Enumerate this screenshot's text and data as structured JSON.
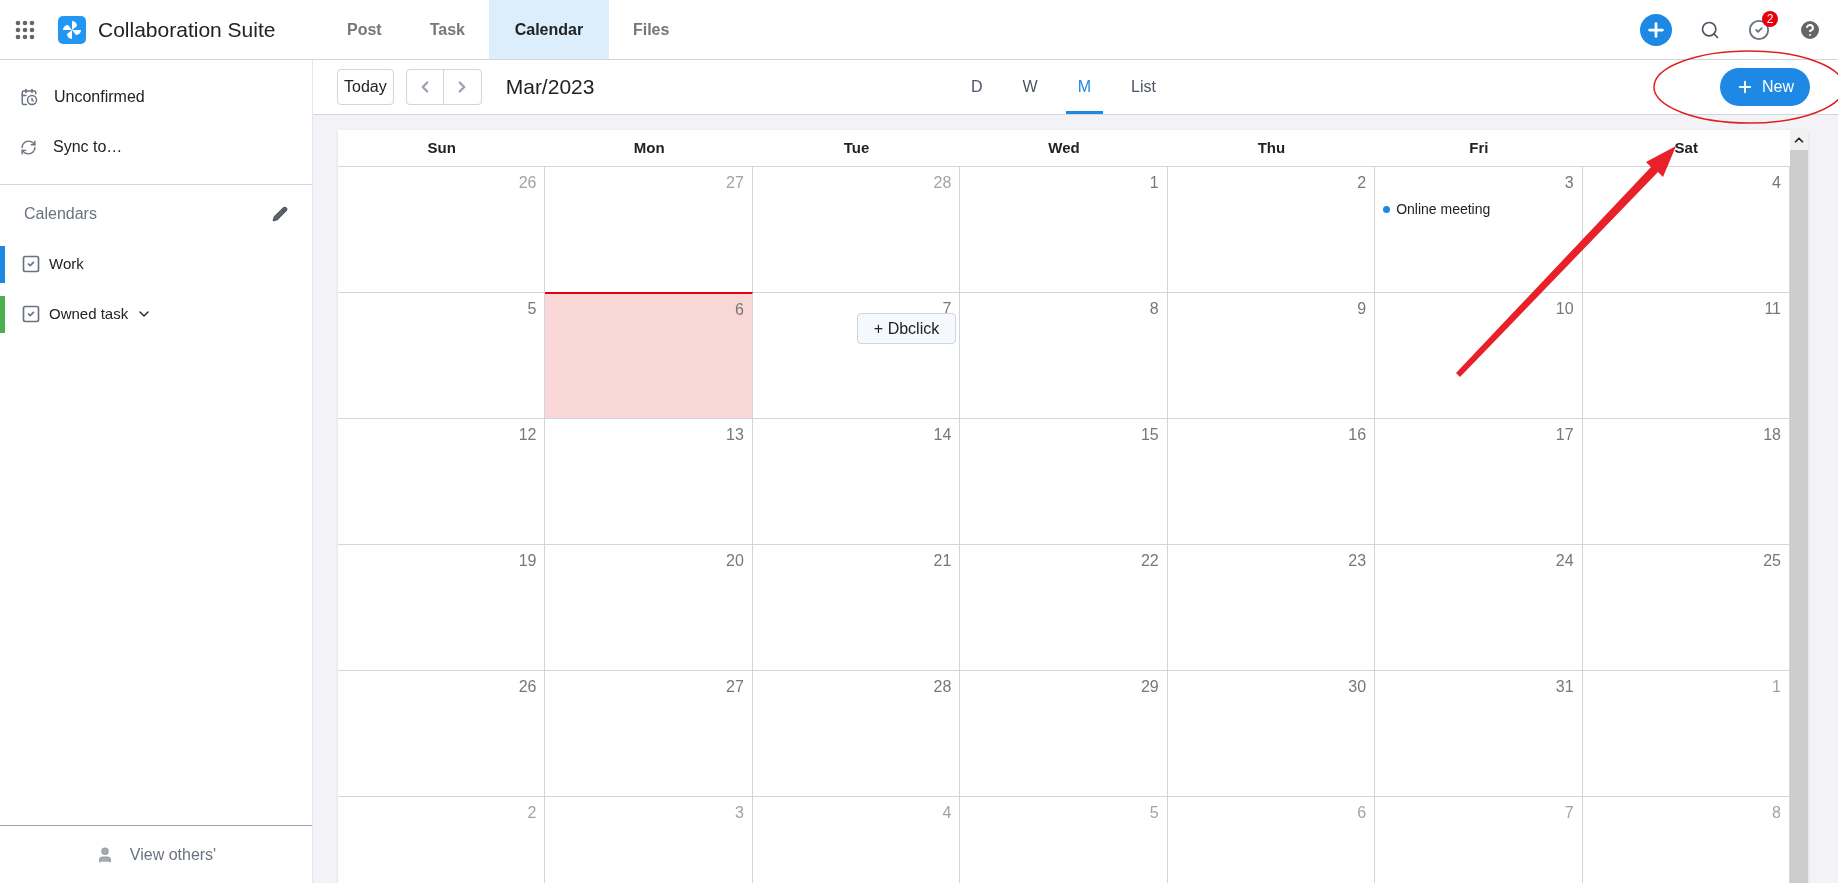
{
  "app": {
    "title": "Collaboration Suite"
  },
  "tabs": [
    {
      "label": "Post",
      "selected": false
    },
    {
      "label": "Task",
      "selected": false
    },
    {
      "label": "Calendar",
      "selected": true
    },
    {
      "label": "Files",
      "selected": false
    }
  ],
  "notifications": {
    "badge": "2"
  },
  "sidebar": {
    "items": [
      {
        "label": "Unconfirmed",
        "kind": "unconfirmed"
      },
      {
        "label": "Sync to…",
        "kind": "sync"
      }
    ],
    "calendars_heading": "Calendars",
    "calendars": [
      {
        "label": "Work",
        "color": "#1e88e5",
        "checked": true,
        "kind": "plain"
      },
      {
        "label": "Owned task",
        "color": "#4caf50",
        "checked": true,
        "kind": "dropdown"
      }
    ],
    "footer": "View others'"
  },
  "toolbar": {
    "today": "Today",
    "period": "Mar/2023",
    "views": [
      {
        "label": "D",
        "selected": false
      },
      {
        "label": "W",
        "selected": false
      },
      {
        "label": "M",
        "selected": true
      },
      {
        "label": "List",
        "selected": false
      }
    ],
    "new_button": "New"
  },
  "calendar": {
    "weekdays": [
      "Sun",
      "Mon",
      "Tue",
      "Wed",
      "Thu",
      "Fri",
      "Sat"
    ],
    "weeks": [
      [
        {
          "day": "26",
          "in_month": false
        },
        {
          "day": "27",
          "in_month": false
        },
        {
          "day": "28",
          "in_month": false
        },
        {
          "day": "1",
          "in_month": true
        },
        {
          "day": "2",
          "in_month": true
        },
        {
          "day": "3",
          "in_month": true,
          "events": [
            {
              "title": "Online meeting",
              "color": "#1e88e5"
            }
          ]
        },
        {
          "day": "4",
          "in_month": true
        }
      ],
      [
        {
          "day": "5",
          "in_month": true
        },
        {
          "day": "6",
          "in_month": true,
          "today": true
        },
        {
          "day": "7",
          "in_month": true,
          "hint": "+ Dbclick"
        },
        {
          "day": "8",
          "in_month": true
        },
        {
          "day": "9",
          "in_month": true
        },
        {
          "day": "10",
          "in_month": true
        },
        {
          "day": "11",
          "in_month": true
        }
      ],
      [
        {
          "day": "12",
          "in_month": true
        },
        {
          "day": "13",
          "in_month": true
        },
        {
          "day": "14",
          "in_month": true
        },
        {
          "day": "15",
          "in_month": true
        },
        {
          "day": "16",
          "in_month": true
        },
        {
          "day": "17",
          "in_month": true
        },
        {
          "day": "18",
          "in_month": true
        }
      ],
      [
        {
          "day": "19",
          "in_month": true
        },
        {
          "day": "20",
          "in_month": true
        },
        {
          "day": "21",
          "in_month": true
        },
        {
          "day": "22",
          "in_month": true
        },
        {
          "day": "23",
          "in_month": true
        },
        {
          "day": "24",
          "in_month": true
        },
        {
          "day": "25",
          "in_month": true
        }
      ],
      [
        {
          "day": "26",
          "in_month": true
        },
        {
          "day": "27",
          "in_month": true
        },
        {
          "day": "28",
          "in_month": true
        },
        {
          "day": "29",
          "in_month": true
        },
        {
          "day": "30",
          "in_month": true
        },
        {
          "day": "31",
          "in_month": true
        },
        {
          "day": "1",
          "in_month": false
        }
      ],
      [
        {
          "day": "2",
          "in_month": false
        },
        {
          "day": "3",
          "in_month": false
        },
        {
          "day": "4",
          "in_month": false
        },
        {
          "day": "5",
          "in_month": false
        },
        {
          "day": "6",
          "in_month": false
        },
        {
          "day": "7",
          "in_month": false
        },
        {
          "day": "8",
          "in_month": false
        }
      ]
    ]
  }
}
